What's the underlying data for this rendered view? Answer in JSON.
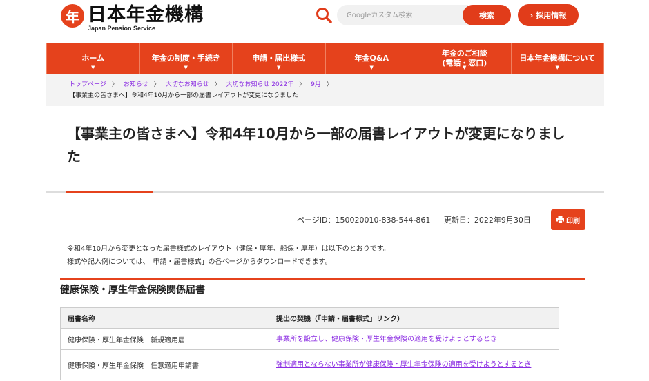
{
  "header": {
    "logo_mark": "年",
    "logo_title": "日本年金機構",
    "logo_sub": "Japan Pension Service",
    "search_placeholder": "Googleカスタム検索",
    "search_button": "検索",
    "recruit_button": "採用情報"
  },
  "nav": [
    {
      "label": "ホーム"
    },
    {
      "label": "年金の制度・手続き"
    },
    {
      "label": "申請・届出様式"
    },
    {
      "label": "年金Q&A"
    },
    {
      "label": "年金のご相談\n(電話・窓口)"
    },
    {
      "label": "日本年金機構について"
    }
  ],
  "breadcrumb": {
    "items": [
      "トップページ",
      "お知らせ",
      "大切なお知らせ",
      "大切なお知らせ 2022年",
      "9月"
    ],
    "current": "【事業主の皆さまへ】令和4年10月から一部の届書レイアウトが変更になりました"
  },
  "page": {
    "title": "【事業主の皆さまへ】令和4年10月から一部の届書レイアウトが変更になりました",
    "page_id": "ページID：150020010-838-544-861",
    "updated": "更新日：2022年9月30日",
    "print_label": "印刷",
    "intro_1": "令和4年10月から変更となった届書様式のレイアウト（健保・厚年、船保・厚年）は以下のとおりです。",
    "intro_2": "様式や記入例については、「申請・届書様式」の各ページからダウンロードできます。"
  },
  "section": {
    "title": "健康保険・厚生年金保険関係届書",
    "table_headers": [
      "届書名称",
      "提出の契機（「申請・届書様式」リンク）"
    ],
    "rows": [
      {
        "name": "健康保険・厚生年金保険　新規適用届",
        "link": "事業所を設立し、健康保険・厚生年金保険の適用を受けようとするとき"
      },
      {
        "name": "健康保険・厚生年金保険　任意適用申請書",
        "link": "強制適用とならない事業所が健康保険・厚生年金保険の適用を受けようとするとき"
      }
    ]
  },
  "colors": {
    "accent": "#e5421c",
    "link": "#8a2be2"
  }
}
